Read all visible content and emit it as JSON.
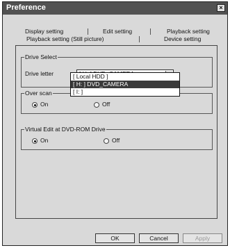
{
  "window": {
    "title": "Preference",
    "close_glyph": "×",
    "close_icon": "close-icon"
  },
  "tabs": {
    "row1": [
      "Display setting",
      "Edit setting",
      "Playback setting"
    ],
    "row2": [
      "Playback setting (Still picture)",
      "Device setting"
    ],
    "active": "Device setting"
  },
  "drive_select": {
    "group_label": "Drive Select",
    "drive_letter_label": "Drive letter",
    "selected_value": "[ H: ] DVD_CAMERA",
    "dropdown_icon": "chevron-down-icon",
    "options": [
      "[ Local HDD ]",
      "[ H: ] DVD_CAMERA",
      "[ I: ]"
    ],
    "highlighted_option": "[ H: ] DVD_CAMERA"
  },
  "over_scan": {
    "group_label": "Over scan",
    "on_label": "On",
    "off_label": "Off",
    "selected": "On"
  },
  "virtual_edit": {
    "group_label": "Virtual Edit at DVD-ROM Drive",
    "on_label": "On",
    "off_label": "Off",
    "selected": "On"
  },
  "buttons": {
    "ok": "OK",
    "cancel": "Cancel",
    "apply": "Apply"
  }
}
